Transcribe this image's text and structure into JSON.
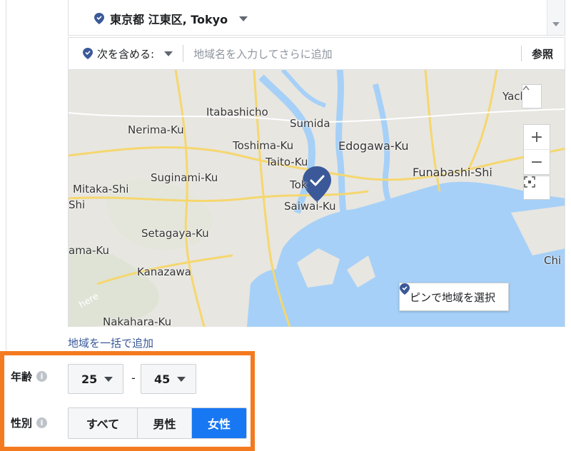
{
  "location": {
    "name": "東京都 江東区, Tokyo"
  },
  "include": {
    "label": "次を含める:",
    "placeholder": "地域名を入力してさらに追加",
    "browse": "参照"
  },
  "map": {
    "labels": {
      "yachi": "Yachi",
      "itabashi": "Itabashicho",
      "sumida": "Sumida",
      "nerima": "Nerima-Ku",
      "toshima": "Toshima-Ku",
      "edogawa": "Edogawa-Ku",
      "taito": "Taito-Ku",
      "funabashi": "Funabashi-Shi",
      "suginami": "Suginami-Ku",
      "tokyo": "Tok",
      "mitaka": "Mitaka-Shi",
      "saiwai": "Saiwai-Ku",
      "shi": "Shi",
      "setagaya": "Setagaya-Ku",
      "ama": "ama-Ku",
      "kanazawa": "Kanazawa",
      "chi": "Chi",
      "here": "here",
      "nakahara": "Nakahara-Ku"
    },
    "zoom_in": "+",
    "zoom_out": "−",
    "pin_select": "ピンで地域を選択"
  },
  "bulk_add": "地域を一括で追加",
  "age": {
    "label": "年齢",
    "min": "25",
    "max": "45",
    "dash": "-"
  },
  "gender": {
    "label": "性別",
    "options": [
      "すべて",
      "男性",
      "女性"
    ],
    "selected": "女性"
  },
  "colors": {
    "accent": "#1877f2",
    "highlight": "#f47a20",
    "water": "#a6d0f7",
    "road": "#f5d76e"
  }
}
